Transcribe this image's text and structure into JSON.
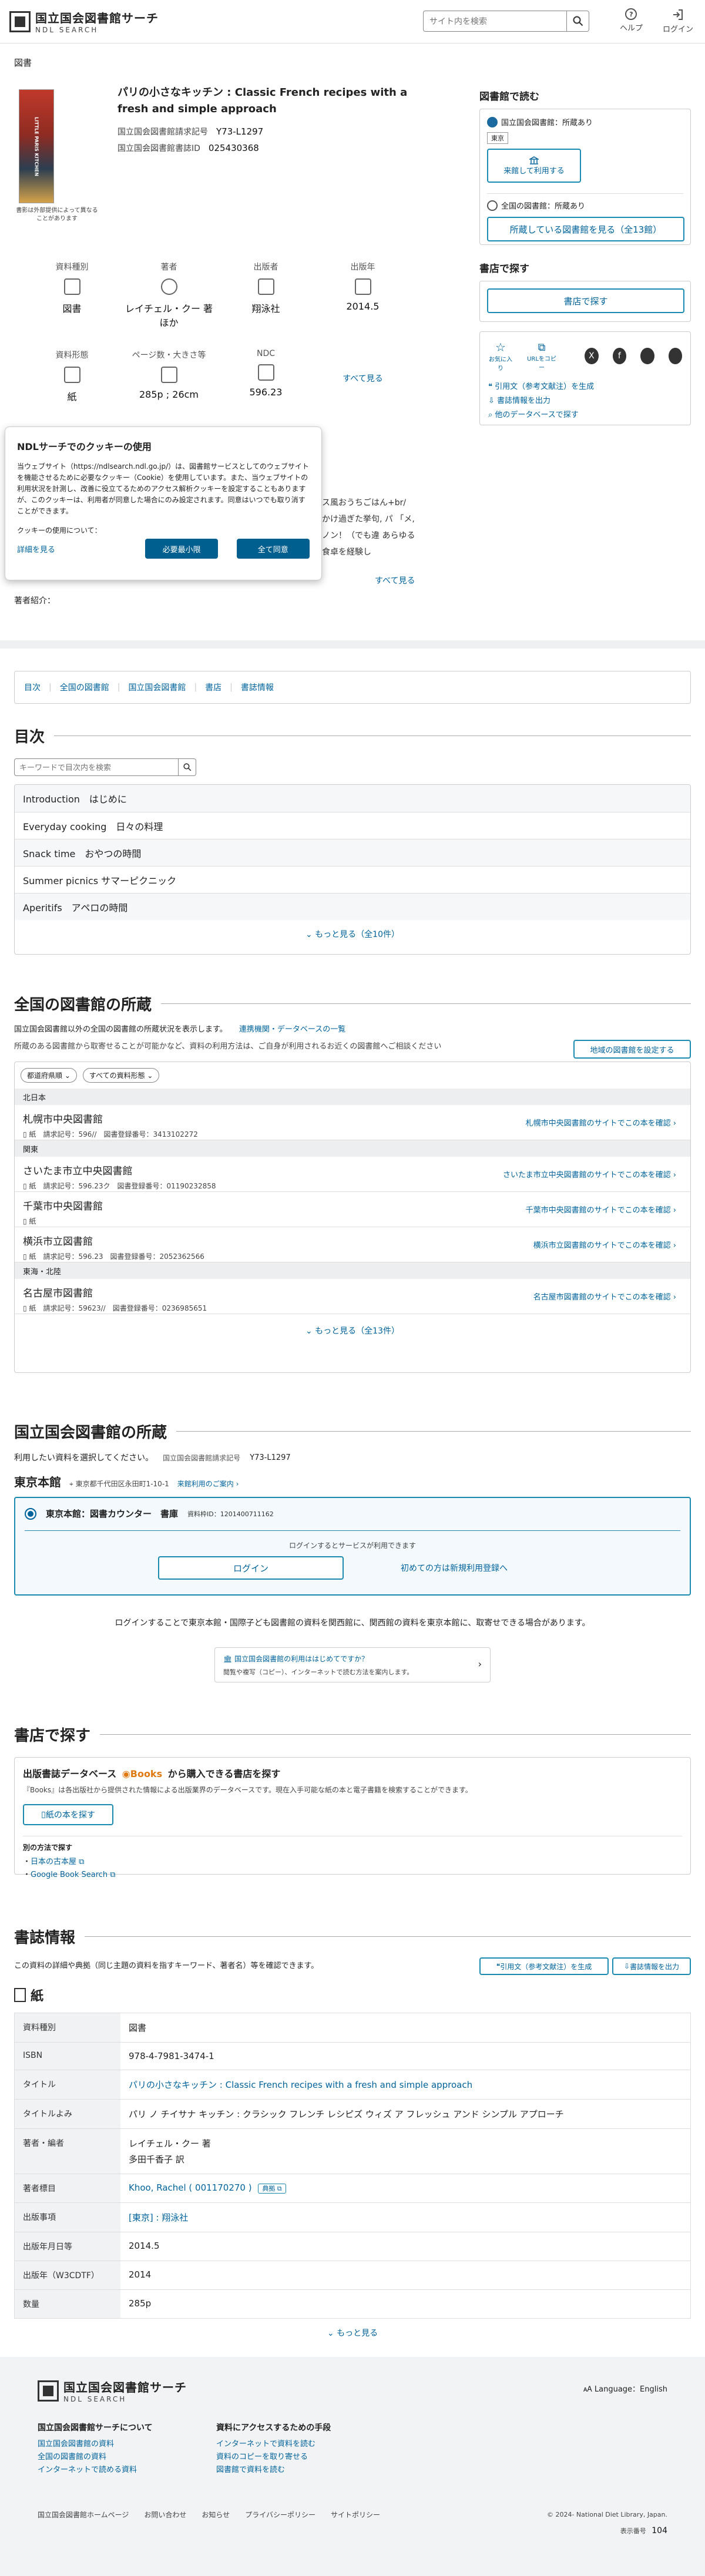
{
  "header": {
    "logo_jp": "国立国会図書館サーチ",
    "logo_en": "NDL SEARCH",
    "search_placeholder": "サイト内を検索",
    "help": "ヘルプ",
    "login": "ログイン"
  },
  "breadcrumb": "図書",
  "book": {
    "title": "パリの小さなキッチン : Classic French recipes with a fresh and simple approach",
    "callno_label": "国立国会図書館請求記号",
    "callno": "Y73-L1297",
    "persistent_label": "国立国会図書館書誌ID",
    "persistent": "025430368",
    "cover_note": "書影は外部提供によって異なることがあります",
    "cover_text": "LITTLE PARIS KITCHEN",
    "attrs": [
      {
        "label": "資料種別",
        "value": "図書"
      },
      {
        "label": "著者",
        "value": "レイチェル・クー 著ほか"
      },
      {
        "label": "出版者",
        "value": "翔泳社"
      },
      {
        "label": "出版年",
        "value": "2014.5"
      },
      {
        "label": "資料形態",
        "value": "紙"
      },
      {
        "label": "ページ数・大きさ等",
        "value": "285p ; 26cm"
      },
      {
        "label": "NDC",
        "value": "596.23"
      }
    ],
    "see_all": "すべて見る",
    "desc": "ス風おうちごはん+br/ かけ過ぎた挙句, パ 「メ, ノン！（でも違 あらゆる食卓を経験し",
    "desc_more": "すべて見る",
    "author_intro": "著者紹介："
  },
  "cookie": {
    "title": "NDLサーチでのクッキーの使用",
    "body": "当ウェブサイト（https://ndlsearch.ndl.go.jp/）は、図書館サービスとしてのウェブサイトを機能させるために必要なクッキー（Cookie）を使用しています。また、当ウェブサイトの利用状況を計測し、改善に役立てるためのアクセス解析クッキーを設定することもありますが、このクッキーは、利用者が同意した場合にのみ設定されます。同意はいつでも取り消すことができます。",
    "use_label": "クッキーの使用について：",
    "details": "詳細を見る",
    "necessary": "必要最小限",
    "accept": "全て同意"
  },
  "sidebar": {
    "read_title": "図書館で読む",
    "ndl_title": "国立国会図書館：所蔵あり",
    "tokyo_badge": "東京",
    "apply_btn": "来館して利用する",
    "all_title": "全国の図書館：所蔵あり",
    "all_btn": "所蔵している図書館を見る（全13館）",
    "shop_title": "書店で探す",
    "shop_btn": "書店で探す",
    "favorite": "お気に入り",
    "url_copy": "URLをコピー",
    "cite": "引用文（参考文献注）を生成",
    "export": "書誌情報を出力",
    "other_db": "他のデータベースで探す"
  },
  "tabs": [
    "目次",
    "全国の図書館",
    "国立国会図書館",
    "書店",
    "書誌情報"
  ],
  "toc": {
    "title": "目次",
    "search_placeholder": "キーワードで目次内を検索",
    "items": [
      "Introduction　はじめに",
      "Everyday cooking　日々の料理",
      "Snack time　おやつの時間",
      "Summer picnics サマーピクニック",
      "Aperitifs　アペロの時間"
    ],
    "more": "もっと見る（全10件）"
  },
  "libraries": {
    "title": "全国の図書館の所蔵",
    "intro": "国立国会図書館以外の全国の図書館の所蔵状況を表示します。",
    "intro_link": "連携機関・データベースの一覧",
    "intro2": "所蔵のある図書館から取寄せることが可能かなど、資料の利用方法は、ご自身が利用されるお近くの図書館へご相談ください",
    "setting_btn": "地域の図書館を設定する",
    "filter1": "都道府県順",
    "filter2": "すべての資料形態",
    "groups": [
      {
        "region": "北日本",
        "libs": [
          {
            "name": "札幌市中央図書館",
            "form": "紙",
            "callno_label": "請求記号：",
            "callno": "596//",
            "reg_label": "図書登録番号：",
            "reg": "3413102272",
            "link": "札幌市中央図書館のサイトでこの本を確認"
          }
        ]
      },
      {
        "region": "関東",
        "libs": [
          {
            "name": "さいたま市立中央図書館",
            "form": "紙",
            "callno_label": "請求記号：",
            "callno": "596.23ク",
            "reg_label": "図書登録番号：",
            "reg": "01190232858",
            "link": "さいたま市立中央図書館のサイトでこの本を確認"
          },
          {
            "name": "千葉市中央図書館",
            "form": "紙",
            "callno_label": "",
            "callno": "",
            "reg_label": "",
            "reg": "",
            "link": "千葉市中央図書館のサイトでこの本を確認"
          },
          {
            "name": "横浜市立図書館",
            "form": "紙",
            "callno_label": "請求記号：",
            "callno": "596.23",
            "reg_label": "図書登録番号：",
            "reg": "2052362566",
            "link": "横浜市立図書館のサイトでこの本を確認"
          }
        ]
      },
      {
        "region": "東海・北陸",
        "libs": [
          {
            "name": "名古屋市図書館",
            "form": "紙",
            "callno_label": "請求記号：",
            "callno": "59623//",
            "reg_label": "図書登録番号：",
            "reg": "0236985651",
            "link": "名古屋市図書館のサイトでこの本を確認"
          }
        ]
      }
    ],
    "more": "もっと見る（全13件）"
  },
  "ndl": {
    "title": "国立国会図書館の所蔵",
    "choose": "利用したい資料を選択してください。",
    "callno_label": "国立国会図書館請求記号",
    "callno": "Y73-L1297",
    "branch": "東京本館",
    "address": "東京都千代田区永田町1-10-1",
    "guide": "来館利用のご案内",
    "item": "東京本館：図書カウンター　書庫",
    "item_id": "資料枠ID：1201400711162",
    "login_note": "ログインするとサービスが利用できます",
    "login_btn": "ログイン",
    "register": "初めての方は新規利用登録へ",
    "note": "ログインすることで東京本館・国際子ども図書館の資料を関西館に、関西館の資料を東京本館に、取寄せできる場合があります。",
    "banner_title": "国立国会図書館の利用ははじめてですか？",
    "banner_sub": "閲覧や複写（コピー）、インターネットで読む方法を案内します。"
  },
  "shops": {
    "title": "書店で探す",
    "db_title_pre": "出版書誌データベース",
    "books_brand": "Books",
    "db_title_post": "から購入できる書店を探す",
    "db_desc": "『Books』は各出版社から提供された情報による出版業界のデータベースです。現在入手可能な紙の本と電子書籍を検索することができます。",
    "paper_btn": "紙の本を探す",
    "other_label": "別の方法で探す",
    "other_links": [
      "日本の古本屋",
      "Google Book Search"
    ]
  },
  "biblio": {
    "title": "書誌情報",
    "intro": "この資料の詳細や典拠（同じ主題の資料を指すキーワード、著者名）等を確認できます。",
    "cite_btn": "引用文（参考文献注）を生成",
    "export_btn": "書誌情報を出力",
    "form_heading": "紙",
    "rows": [
      {
        "k": "資料種別",
        "v": "図書"
      },
      {
        "k": "ISBN",
        "v": "978-4-7981-3474-1"
      },
      {
        "k": "タイトル",
        "v": "パリの小さなキッチン : Classic French recipes with a fresh and simple approach"
      },
      {
        "k": "タイトルよみ",
        "v": "パリ ノ チイサナ キッチン : クラシック フレンチ レシピズ ウィズ ア フレッシュ アンド シンプル アプローチ"
      },
      {
        "k": "著者・編者",
        "v": "レイチェル・クー 著",
        "v2": "多田千香子 訳"
      },
      {
        "k": "著者標目",
        "v": "Khoo, Rachel ( 001170270 )",
        "badge": "典拠"
      },
      {
        "k": "出版事項",
        "v": "[東京] : 翔泳社"
      },
      {
        "k": "出版年月日等",
        "v": "2014.5"
      },
      {
        "k": "出版年（W3CDTF）",
        "v": "2014"
      },
      {
        "k": "数量",
        "v": "285p"
      }
    ],
    "more": "もっと見る"
  },
  "footer": {
    "logo_jp": "国立国会図書館サーチ",
    "logo_en": "NDL SEARCH",
    "lang": "Language：English",
    "col1_title": "国立国会図書館サーチについて",
    "col1": [
      "国立国会図書館の資料",
      "全国の図書館の資料",
      "インターネットで読める資料"
    ],
    "col2_title": "資料にアクセスするための手段",
    "col2": [
      "インターネットで資料を読む",
      "資料のコピーを取り寄せる",
      "図書館で資料を読む"
    ],
    "bottom": [
      "国立国会図書館ホームページ",
      "お問い合わせ",
      "お知らせ",
      "プライバシーポリシー",
      "サイトポリシー"
    ],
    "copyright": "© 2024- National Diet Library, Japan.",
    "page_label": "表示番号",
    "page_no": "104"
  }
}
